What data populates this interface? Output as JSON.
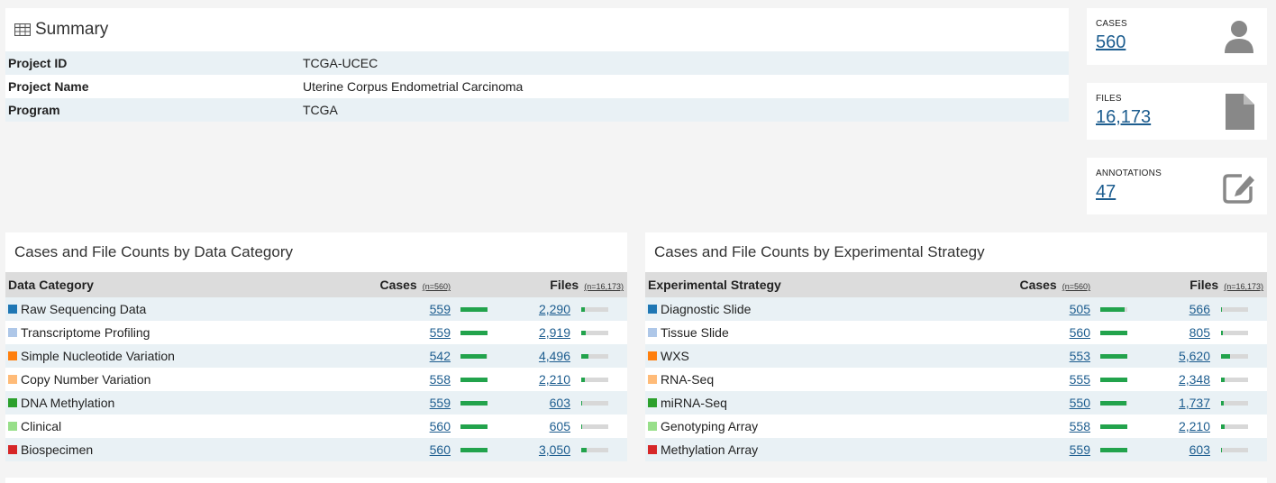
{
  "summary": {
    "title": "Summary",
    "rows": [
      {
        "label": "Project ID",
        "value": "TCGA-UCEC"
      },
      {
        "label": "Project Name",
        "value": "Uterine Corpus Endometrial Carcinoma"
      },
      {
        "label": "Program",
        "value": "TCGA"
      }
    ]
  },
  "cards": [
    {
      "label": "CASES",
      "value": "560",
      "icon": "user-icon"
    },
    {
      "label": "FILES",
      "value": "16,173",
      "icon": "file-icon"
    },
    {
      "label": "ANNOTATIONS",
      "value": "47",
      "icon": "edit-icon"
    }
  ],
  "colors": {
    "link": "#1d5d8f",
    "bar": "#22a34c",
    "bar_track": "#d8d8d8",
    "header_bg": "#dcdcdc",
    "stripe": "#e9f1f5"
  },
  "panels": [
    {
      "title": "Cases and File Counts by Data Category",
      "col_category": "Data Category",
      "col_cases": "Cases",
      "col_cases_n": "(n=560)",
      "col_files": "Files",
      "col_files_n": "(n=16,173)",
      "rows": [
        {
          "label": "Raw Sequencing Data",
          "color": "#1f77b4",
          "cases": "559",
          "files": "2,290",
          "cases_frac": 0.998,
          "files_frac": 0.142
        },
        {
          "label": "Transcriptome Profiling",
          "color": "#aec7e8",
          "cases": "559",
          "files": "2,919",
          "cases_frac": 0.998,
          "files_frac": 0.18
        },
        {
          "label": "Simple Nucleotide Variation",
          "color": "#ff7f0e",
          "cases": "542",
          "files": "4,496",
          "cases_frac": 0.968,
          "files_frac": 0.278
        },
        {
          "label": "Copy Number Variation",
          "color": "#ffbb78",
          "cases": "558",
          "files": "2,210",
          "cases_frac": 0.996,
          "files_frac": 0.137
        },
        {
          "label": "DNA Methylation",
          "color": "#2ca02c",
          "cases": "559",
          "files": "603",
          "cases_frac": 0.998,
          "files_frac": 0.037
        },
        {
          "label": "Clinical",
          "color": "#98df8a",
          "cases": "560",
          "files": "605",
          "cases_frac": 1.0,
          "files_frac": 0.037
        },
        {
          "label": "Biospecimen",
          "color": "#d62728",
          "cases": "560",
          "files": "3,050",
          "cases_frac": 1.0,
          "files_frac": 0.189
        }
      ]
    },
    {
      "title": "Cases and File Counts by Experimental Strategy",
      "col_category": "Experimental Strategy",
      "col_cases": "Cases",
      "col_cases_n": "(n=560)",
      "col_files": "Files",
      "col_files_n": "(n=16,173)",
      "rows": [
        {
          "label": "Diagnostic Slide",
          "color": "#1f77b4",
          "cases": "505",
          "files": "566",
          "cases_frac": 0.902,
          "files_frac": 0.035
        },
        {
          "label": "Tissue Slide",
          "color": "#aec7e8",
          "cases": "560",
          "files": "805",
          "cases_frac": 1.0,
          "files_frac": 0.05
        },
        {
          "label": "WXS",
          "color": "#ff7f0e",
          "cases": "553",
          "files": "5,620",
          "cases_frac": 0.988,
          "files_frac": 0.347
        },
        {
          "label": "RNA-Seq",
          "color": "#ffbb78",
          "cases": "555",
          "files": "2,348",
          "cases_frac": 0.991,
          "files_frac": 0.145
        },
        {
          "label": "miRNA-Seq",
          "color": "#2ca02c",
          "cases": "550",
          "files": "1,737",
          "cases_frac": 0.982,
          "files_frac": 0.107
        },
        {
          "label": "Genotyping Array",
          "color": "#98df8a",
          "cases": "558",
          "files": "2,210",
          "cases_frac": 0.996,
          "files_frac": 0.137
        },
        {
          "label": "Methylation Array",
          "color": "#d62728",
          "cases": "559",
          "files": "603",
          "cases_frac": 0.998,
          "files_frac": 0.037
        }
      ]
    }
  ]
}
